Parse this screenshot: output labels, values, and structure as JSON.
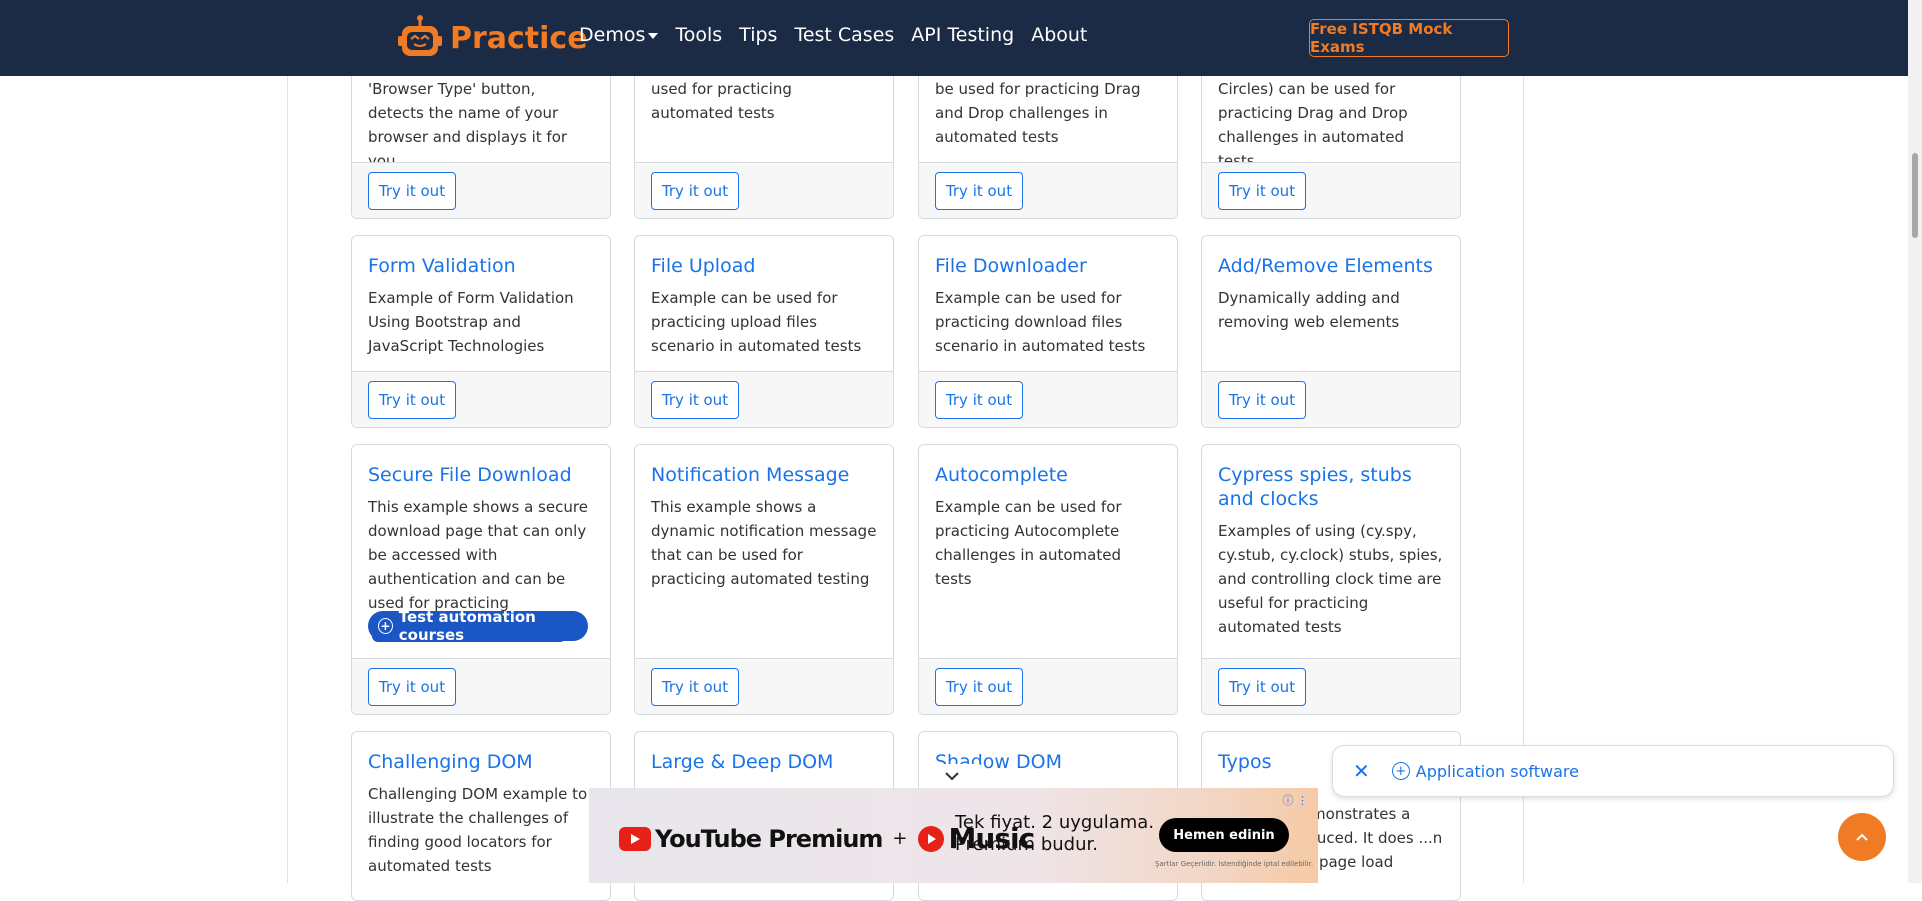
{
  "navbar": {
    "brand": "Practice",
    "links": [
      "Demos",
      "Tools",
      "Tips",
      "Test Cases",
      "API Testing",
      "About"
    ],
    "cta": "Free ISTQB Mock Exams"
  },
  "cards_row0": [
    {
      "text": "'Browser Type' button, detects the name of your browser and displays it for you",
      "button": "Try it out"
    },
    {
      "text": "used for practicing automated tests",
      "button": "Try it out"
    },
    {
      "text": "be used for practicing Drag and Drop challenges in automated tests",
      "button": "Try it out"
    },
    {
      "text": "Circles) can be used for practicing Drag and Drop challenges in automated tests",
      "button": "Try it out"
    }
  ],
  "cards_row1": [
    {
      "title": "Form Validation",
      "text": "Example of Form Validation Using Bootstrap and JavaScript Technologies",
      "button": "Try it out"
    },
    {
      "title": "File Upload",
      "text": "Example can be used for practicing upload files scenario in automated tests",
      "button": "Try it out"
    },
    {
      "title": "File Downloader",
      "text": "Example can be used for practicing download files scenario in automated tests",
      "button": "Try it out"
    },
    {
      "title": "Add/Remove Elements",
      "text": "Dynamically adding and removing web elements",
      "button": "Try it out"
    }
  ],
  "cards_row2": [
    {
      "title": "Secure File Download",
      "text": "This example shows a secure download page that can only be accessed with authentication and can be used for practicing automated tests",
      "button": "Try it out"
    },
    {
      "title": "Notification Message",
      "text": "This example shows a dynamic notification message that can be used for practicing automated testing",
      "button": "Try it out"
    },
    {
      "title": "Autocomplete",
      "text": "Example can be used for practicing Autocomplete challenges in automated tests",
      "button": "Try it out"
    },
    {
      "title": "Cypress spies, stubs and clocks",
      "text": "Examples of using (cy.spy, cy.stub, cy.clock) stubs, spies, and controlling clock time are useful for practicing automated tests",
      "button": "Try it out"
    }
  ],
  "cards_row3": [
    {
      "title": "Challenging DOM",
      "text": "Challenging DOM example to illustrate the challenges of finding good locators for automated tests"
    },
    {
      "title": "Large & Deep DOM",
      "text": ""
    },
    {
      "title": "Shadow DOM",
      "text": ""
    },
    {
      "title": "Typos",
      "text": "...demonstrates a ...roduced. It does ...n each page load"
    }
  ],
  "chip": {
    "label": "Test automation courses"
  },
  "app_pill": {
    "label": "Application software"
  },
  "ad": {
    "brand1": "YouTube Premium",
    "plus": "+",
    "brand2": "Music",
    "tagline1": "Tek fiyat. 2 uygulama.",
    "tagline2": "Premium budur.",
    "cta": "Hemen edinin",
    "disclaimer": "Şartlar Geçerlidir. İstendiğinde iptal edilebilir."
  },
  "colors": {
    "navbar": "#1b2a45",
    "brand": "#f07b24",
    "link": "#1a73e8"
  }
}
